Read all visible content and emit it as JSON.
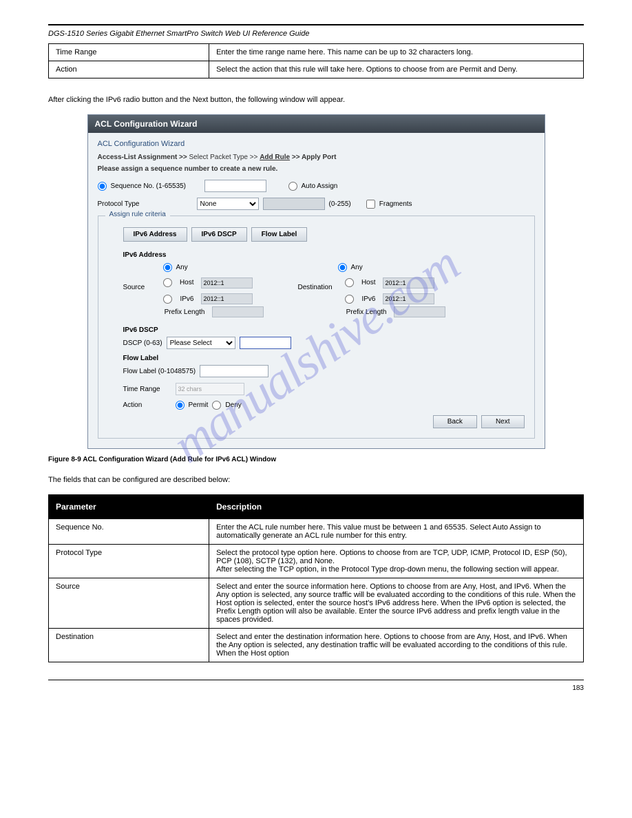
{
  "header": {
    "title": "DGS-1510 Series Gigabit Ethernet SmartPro Switch Web UI Reference Guide"
  },
  "watermark": "manualshive.com",
  "table1": {
    "rows": [
      {
        "param": "Time Range",
        "desc": "Enter the time range name here. This name can be up to 32 characters long."
      },
      {
        "param": "Action",
        "desc": "Select the action that this rule will take here. Options to choose from are Permit and Deny."
      }
    ]
  },
  "intro": "After clicking the IPv6 radio button and the Next button, the following window will appear.",
  "wizard": {
    "title": "ACL Configuration Wizard",
    "section": "ACL Configuration Wizard",
    "breadcrumb": {
      "a": "Access-List Assignment >>",
      "b": "Select Packet Type >>",
      "c": "Add Rule",
      "d": ">> Apply Port"
    },
    "instr": "Please assign a sequence number to create a new rule.",
    "seq": {
      "label": "Sequence No. (1-65535)",
      "auto": "Auto Assign"
    },
    "proto": {
      "label": "Protocol Type",
      "value": "None",
      "range": "(0-255)",
      "frag": "Fragments"
    },
    "fs_legend": "Assign rule criteria",
    "tabs": {
      "a": "IPv6 Address",
      "b": "IPv6 DSCP",
      "c": "Flow Label"
    },
    "addr": {
      "head": "IPv6 Address",
      "src_label": "Source",
      "dst_label": "Destination",
      "any": "Any",
      "host": "Host",
      "ipv6": "IPv6",
      "prefix": "Prefix Length",
      "ph_host": "2012::1",
      "ph_ipv6": "2012::1"
    },
    "dscp": {
      "head": "IPv6 DSCP",
      "label": "DSCP (0-63)",
      "sel": "Please Select"
    },
    "flow": {
      "head": "Flow Label",
      "label": "Flow Label (0-1048575)"
    },
    "tr": {
      "label": "Time Range",
      "ph": "32 chars"
    },
    "act": {
      "label": "Action",
      "permit": "Permit",
      "deny": "Deny"
    },
    "back": "Back",
    "next": "Next"
  },
  "figcap": "Figure 8-9 ACL Configuration Wizard (Add Rule for IPv6 ACL) Window",
  "para2": "The fields that can be configured are described below:",
  "table2": {
    "h1": "Parameter",
    "h2": "Description",
    "rows": [
      {
        "param": "Sequence No.",
        "desc": "Enter the ACL rule number here. This value must be between 1 and 65535. Select Auto Assign to automatically generate an ACL rule number for this entry."
      },
      {
        "param": "Protocol Type",
        "desc": "Select the protocol type option here. Options to choose from are TCP, UDP, ICMP, Protocol ID, ESP (50), PCP (108), SCTP (132), and None. \nAfter selecting the TCP option, in the Protocol Type drop-down menu, the following section will appear."
      },
      {
        "param": "Source",
        "desc": "Select and enter the source information here. Options to choose from are Any, Host, and IPv6. When the Any option is selected, any source traffic will be evaluated according to the conditions of this rule. When the Host option is selected, enter the source host's IPv6 address here. When the IPv6 option is selected, the Prefix Length option will also be available. Enter the source IPv6 address and prefix length value in the spaces provided."
      },
      {
        "param": "Destination",
        "desc": "Select and enter the destination information here. Options to choose from are Any, Host, and IPv6. When the Any option is selected, any destination traffic will be evaluated according to the conditions of this rule. When the Host option"
      }
    ]
  },
  "footer": {
    "page": "183"
  }
}
